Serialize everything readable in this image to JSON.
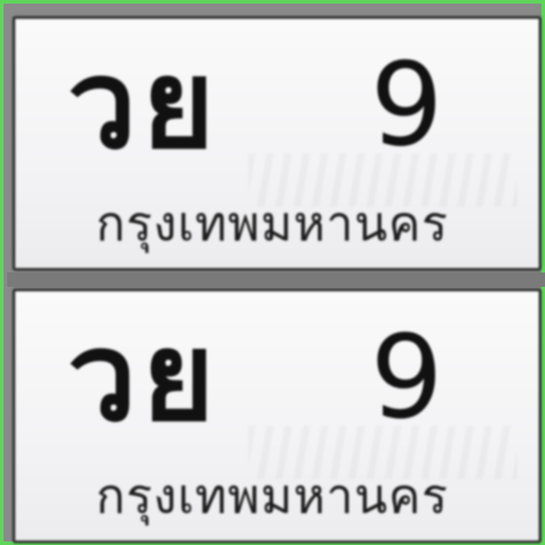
{
  "plates": [
    {
      "letters": "วย",
      "number": "9",
      "province": "กรุงเทพมหานคร"
    },
    {
      "letters": "วย",
      "number": "9",
      "province": "กรุงเทพมหานคร"
    }
  ],
  "colors": {
    "frame": "#5fd65a",
    "plate_background": "#f4f4f6",
    "text": "#111111"
  }
}
